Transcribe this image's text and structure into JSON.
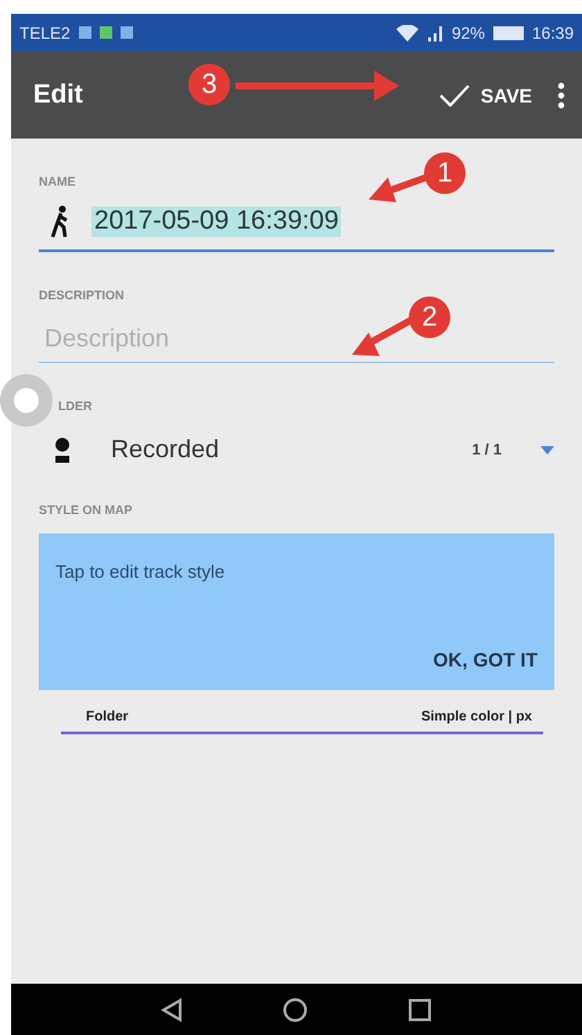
{
  "status_bar": {
    "carrier": "TELE2",
    "battery": "92%",
    "time": "16:39"
  },
  "toolbar": {
    "title": "Edit",
    "action": "SAVE"
  },
  "name_field": {
    "label": "NAME",
    "value": "2017-05-09 16:39:09"
  },
  "description_field": {
    "label": "DESCRIPTION",
    "placeholder": "Description"
  },
  "folder": {
    "label": "LDER",
    "value": "Recorded",
    "count": "1 / 1"
  },
  "style_on_map": {
    "label": "STYLE ON MAP",
    "hint": "Tap to edit track style",
    "hint_button": "OK, GOT IT",
    "folder": "Folder",
    "style": "Simple color | px"
  },
  "annotations": [
    {
      "number": "1"
    },
    {
      "number": "2"
    },
    {
      "number": "3"
    }
  ]
}
